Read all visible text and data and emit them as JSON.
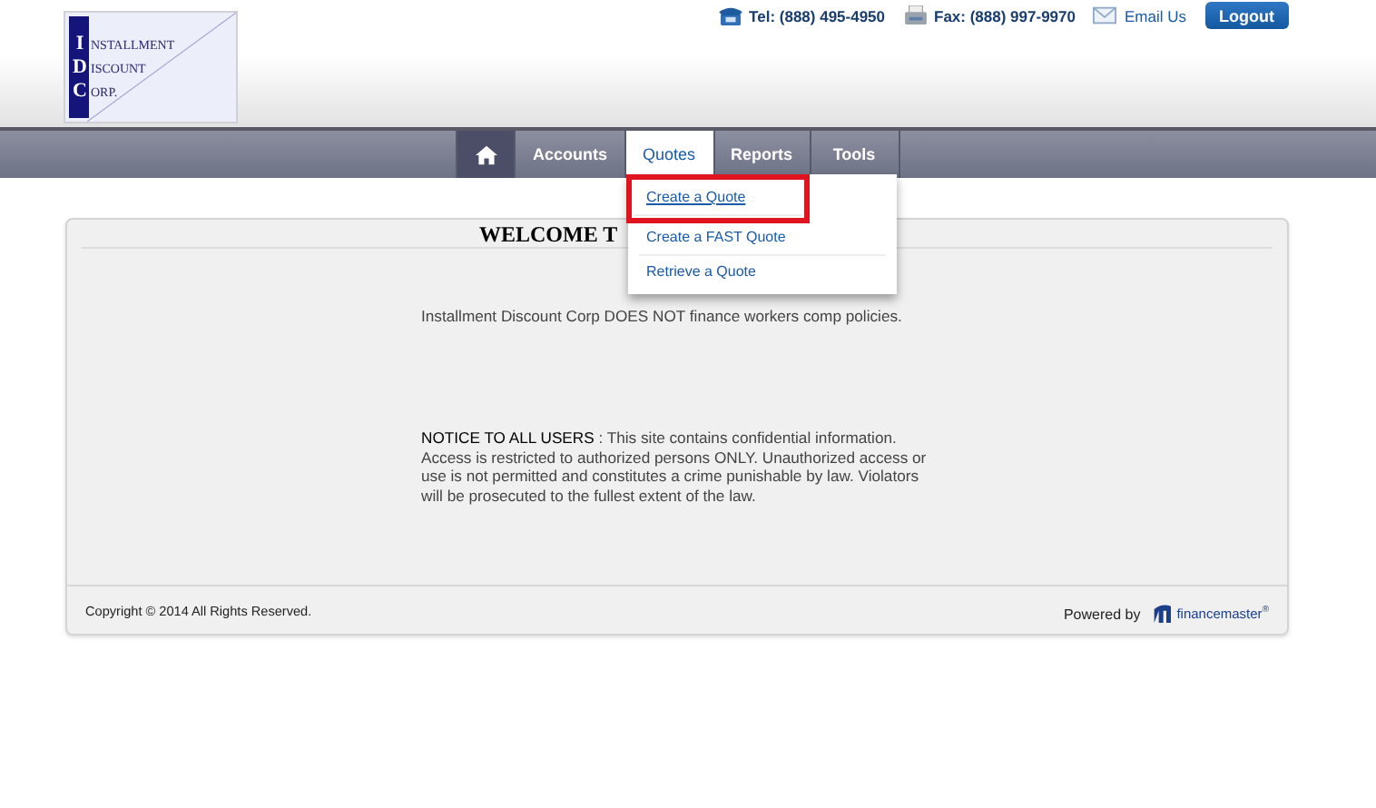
{
  "logo": [
    {
      "initial": "I",
      "rest": "NSTALLMENT"
    },
    {
      "initial": "D",
      "rest": "ISCOUNT"
    },
    {
      "initial": "C",
      "rest": "ORP."
    }
  ],
  "contacts": [
    {
      "kind": "phone",
      "text": "Tel: (888) 495-4950"
    },
    {
      "kind": "fax",
      "text": "Fax: (888) 997-9970"
    },
    {
      "kind": "mail",
      "text": "Email Us"
    }
  ],
  "logout": "Logout",
  "nav": [
    {
      "kind": "home",
      "selected": false
    },
    {
      "label": "Accounts",
      "selected": false
    },
    {
      "label": "Quotes",
      "selected": true
    },
    {
      "label": "Reports",
      "selected": false
    },
    {
      "label": "Tools",
      "selected": false
    }
  ],
  "dropdown": [
    {
      "label": "Create a Quote",
      "highlighted": true
    },
    {
      "label": "Create a FAST Quote",
      "highlighted": false
    },
    {
      "label": "Retrieve a Quote",
      "highlighted": false
    }
  ],
  "welcome": "WELCOME T",
  "message": "Installment Discount Corp DOES NOT finance workers comp policies.",
  "notice": {
    "heading": "NOTICE TO ALL USERS",
    "body": " : This site contains confidential information. Access is restricted to authorized persons ONLY. Unauthorized access or use is not permitted and constitutes a crime punishable by law. Violators will be prosecuted to the fullest extent of the law."
  },
  "footer": {
    "copyright": "Copyright © 2014 All Rights Reserved.",
    "powered": "Powered by",
    "brand": "financemaster",
    "brand_mark": "®"
  }
}
